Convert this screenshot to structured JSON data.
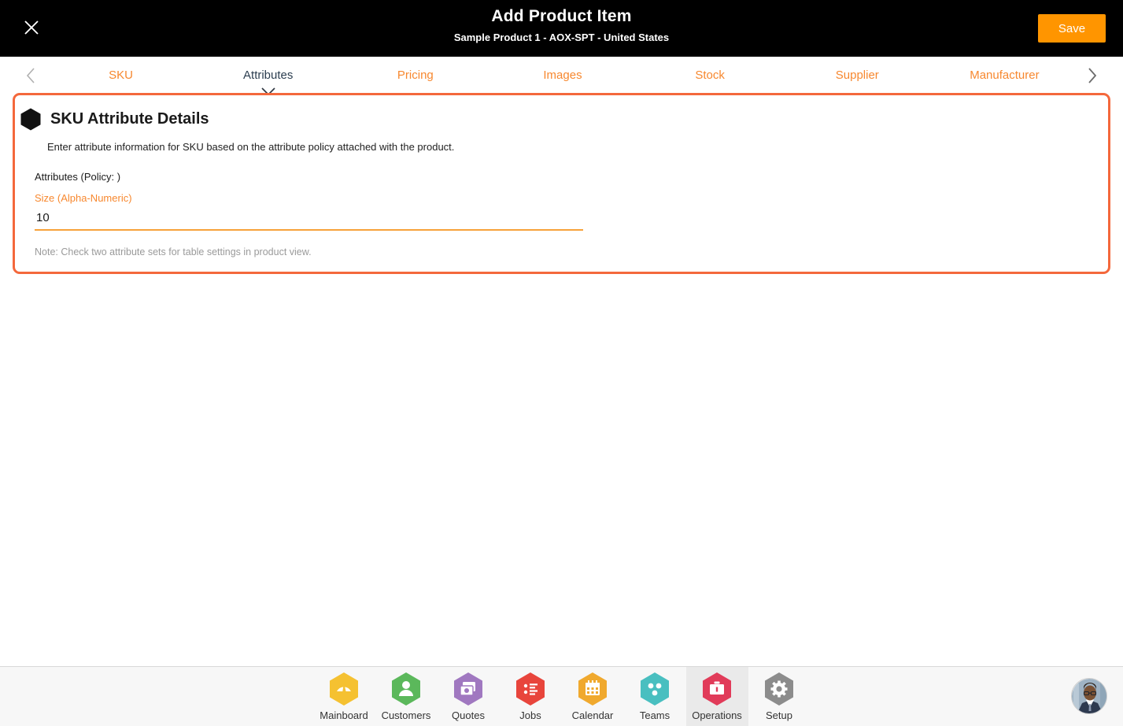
{
  "header": {
    "close_icon": "close-icon",
    "title": "Add Product Item",
    "subtitle": "Sample Product 1 - AOX-SPT - United States",
    "save_label": "Save",
    "background": "#000000",
    "save_color": "#FF9500"
  },
  "tabstrip": {
    "prev_icon": "chevron-left-icon",
    "next_icon": "chevron-right-icon",
    "active_index": 1,
    "active_color": "#2C3E50",
    "inactive_color": "#F7882F",
    "tabs": [
      {
        "label": "SKU"
      },
      {
        "label": "Attributes"
      },
      {
        "label": "Pricing"
      },
      {
        "label": "Images"
      },
      {
        "label": "Stock"
      },
      {
        "label": "Supplier"
      },
      {
        "label": "Manufacturer"
      }
    ]
  },
  "card": {
    "border_color": "#F4683C",
    "icon": "hexagon-icon",
    "title": "SKU Attribute Details",
    "description": "Enter attribute information for SKU based on the attribute policy attached with the product.",
    "group_label": "Attributes (Policy: )",
    "field": {
      "label": "Size (Alpha-Numeric)",
      "value": "10",
      "placeholder": "",
      "label_color": "#F7882F",
      "underline_color": "#F7A23A"
    },
    "note": "Note: Check two attribute sets for table settings in product view."
  },
  "bottomnav": {
    "active_index": 6,
    "items": [
      {
        "label": "Mainboard",
        "icon": "mainboard-icon",
        "color": "#F5C131"
      },
      {
        "label": "Customers",
        "icon": "customers-icon",
        "color": "#5BB85B"
      },
      {
        "label": "Quotes",
        "icon": "quotes-icon",
        "color": "#A078C0"
      },
      {
        "label": "Jobs",
        "icon": "jobs-icon",
        "color": "#E8453C"
      },
      {
        "label": "Calendar",
        "icon": "calendar-icon",
        "color": "#F0A92E"
      },
      {
        "label": "Teams",
        "icon": "teams-icon",
        "color": "#49BFC0"
      },
      {
        "label": "Operations",
        "icon": "operations-icon",
        "color": "#E13B59"
      },
      {
        "label": "Setup",
        "icon": "setup-icon",
        "color": "#8C8C8C"
      }
    ],
    "avatar": "user-avatar"
  }
}
